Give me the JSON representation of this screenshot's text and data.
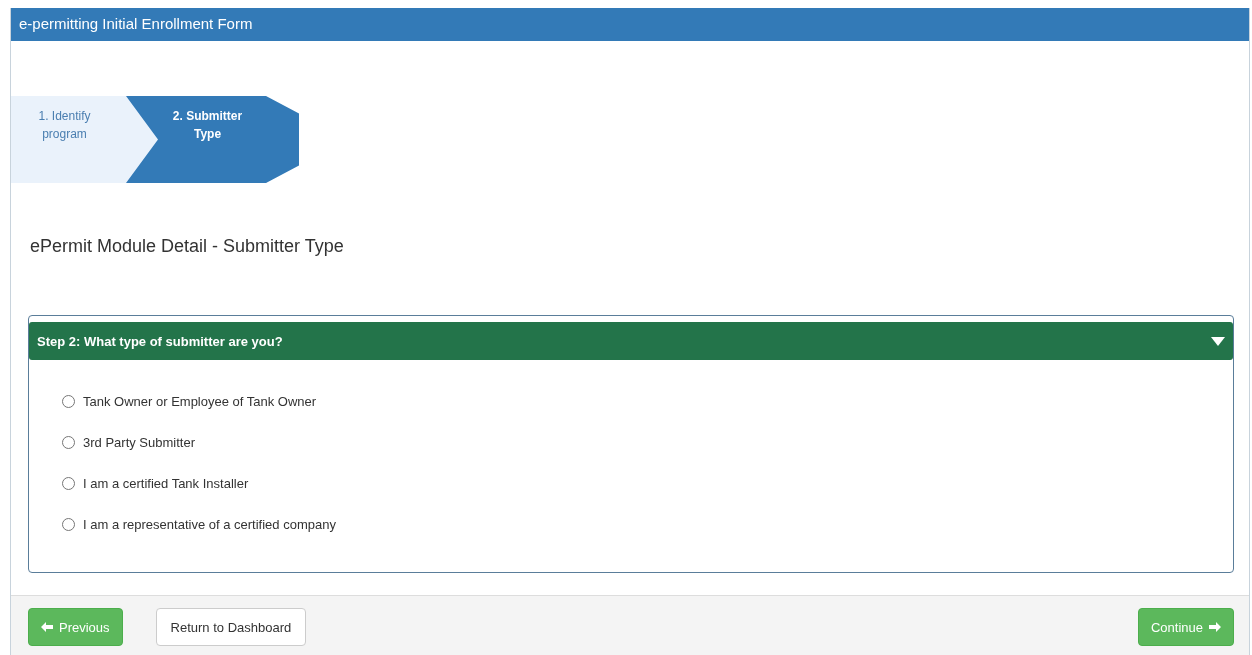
{
  "window": {
    "title": "e-permitting Initial Enrollment Form"
  },
  "steps": [
    {
      "label": "1. Identify program",
      "selected": false
    },
    {
      "label": "2. Submitter Type",
      "selected": true
    }
  ],
  "heading": "ePermit Module Detail - Submitter Type",
  "panel": {
    "title": "Step 2: What type of submitter are you?",
    "expanded": true,
    "options": [
      {
        "label": "Tank Owner or Employee of Tank Owner",
        "checked": false
      },
      {
        "label": "3rd Party Submitter",
        "checked": false
      },
      {
        "label": "I am a certified Tank Installer",
        "checked": false
      },
      {
        "label": "I am a representative of a certified company",
        "checked": false
      }
    ]
  },
  "buttons": [
    {
      "kind": "previous",
      "label": "Previous"
    },
    {
      "kind": "plain",
      "label": "Return to Dashboard"
    },
    {
      "kind": "next",
      "label": "Continue"
    }
  ]
}
